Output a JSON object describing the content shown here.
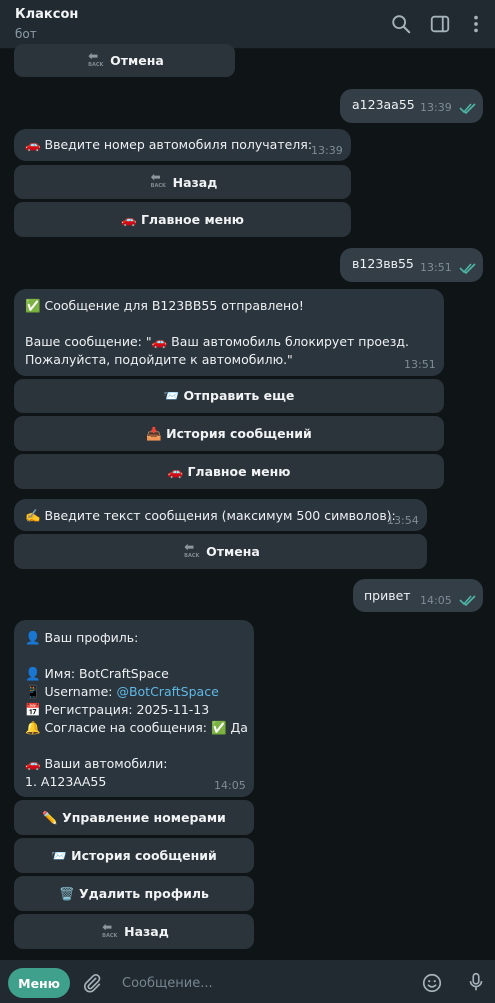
{
  "header": {
    "title": "Клаксон",
    "subtitle": "бот"
  },
  "messages": {
    "m1": {
      "text": "а123аа55",
      "time": "13:39"
    },
    "m2": {
      "text": "🚗 Введите номер автомобиля получателя:",
      "time": "13:39"
    },
    "m3": {
      "text": "в123вв55",
      "time": "13:51"
    },
    "m4": {
      "line1": "✅ Сообщение для В123ВВ55 отправлено!",
      "line2": "Ваше сообщение: \"🚗 Ваш автомобиль блокирует проезд.",
      "line3": "Пожалуйста, подойдите к автомобилю.\"",
      "time": "13:51"
    },
    "m5": {
      "text": "✍️ Введите текст сообщения (максимум 500 символов):",
      "time": "13:54"
    },
    "m6": {
      "text": "привет",
      "time": "14:05"
    },
    "m7": {
      "line1": "👤 Ваш профиль:",
      "line2": "👤 Имя: BotCraftSpace",
      "line3_prefix": "📱 Username: ",
      "line3_link": "@BotCraftSpace",
      "line4": "📅 Регистрация: 2025-11-13",
      "line5": "🔔 Согласие на сообщения: ✅ Да",
      "line6": "🚗 Ваши автомобили:",
      "line7": "1. А123АА55",
      "time": "14:05"
    }
  },
  "buttons": {
    "cancel_top": "Отмена",
    "back1": "Назад",
    "main_menu1": "🚗 Главное меню",
    "send_more": "📨 Отправить еще",
    "history1": "📥 История сообщений",
    "main_menu2": "🚗 Главное меню",
    "cancel2": "Отмена",
    "manage_numbers": "✏️ Управление номерами",
    "history2": "📨 История сообщений",
    "delete_profile": "🗑️ Удалить профиль",
    "back2": "Назад"
  },
  "back_icon_text": "BACK",
  "bottom": {
    "menu_label": "Меню",
    "placeholder": "Сообщение..."
  },
  "icons": [
    "search-icon",
    "sidebar-icon",
    "more-icon",
    "attach-icon",
    "emoji-icon",
    "mic-icon",
    "read-ticks-icon"
  ],
  "colors": {
    "accent": "#3fa08c",
    "link": "#5fb8e6",
    "ticks": "#4fb6a6"
  }
}
